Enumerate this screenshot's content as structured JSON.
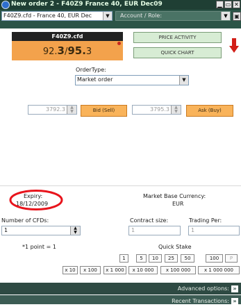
{
  "window": {
    "title": "New order 2 - F40Z9 France 40, EUR Dec09",
    "min": "▁",
    "max": "▭",
    "close": "✕"
  },
  "toolbar": {
    "instrument_value": "F40Z9.cfd - France 40, EUR Dec",
    "account_role_placeholder": "Account / Role:",
    "extra_icon": "▣"
  },
  "quote": {
    "symbol": "F40Z9.cfd",
    "bid_prefix": "92.",
    "bid_small": "3",
    "sep": "/",
    "ask_big": "95.",
    "ask_small": "3"
  },
  "buttons": {
    "price_activity": "PRICE ACTIVITY",
    "quick_chart": "QUICK CHART"
  },
  "order": {
    "type_label": "OrderType:",
    "type_value": "Market order",
    "bid_price": "3792.3",
    "bid_label": "Bid (Sell)",
    "ask_price": "3795.3",
    "ask_label": "Ask (Buy)"
  },
  "info": {
    "expiry_label": "Expiry:",
    "expiry_value": "18/12/2009",
    "currency_label": "Market Base Currency:",
    "currency_value": "EUR",
    "num_cfds_label": "Number of CFDs:",
    "num_cfds_value": "1",
    "contract_size_label": "Contract size:",
    "contract_size_value": "1",
    "trading_per_label": "Trading Per:",
    "trading_per_value": "1",
    "point_note": "*1 point = 1",
    "quick_stake_label": "Quick Stake"
  },
  "stake_row1": [
    "1",
    "5",
    "10",
    "25",
    "50",
    "100",
    "P"
  ],
  "stake_row2": [
    "x 10",
    "x 100",
    "x 1 000",
    "x 10 000",
    "x 100 000",
    "x 1 000 000"
  ],
  "footer": {
    "advanced": "Advanced options:",
    "recent": "Recent Transactions:",
    "chevron": "»"
  },
  "colors": {
    "highlight_ring": "#e8141c",
    "titlebar": "#1f3f34",
    "quote_orange": "#f3a24c",
    "button_green": "#d7ecd4",
    "arrow_red": "#d21e18"
  }
}
